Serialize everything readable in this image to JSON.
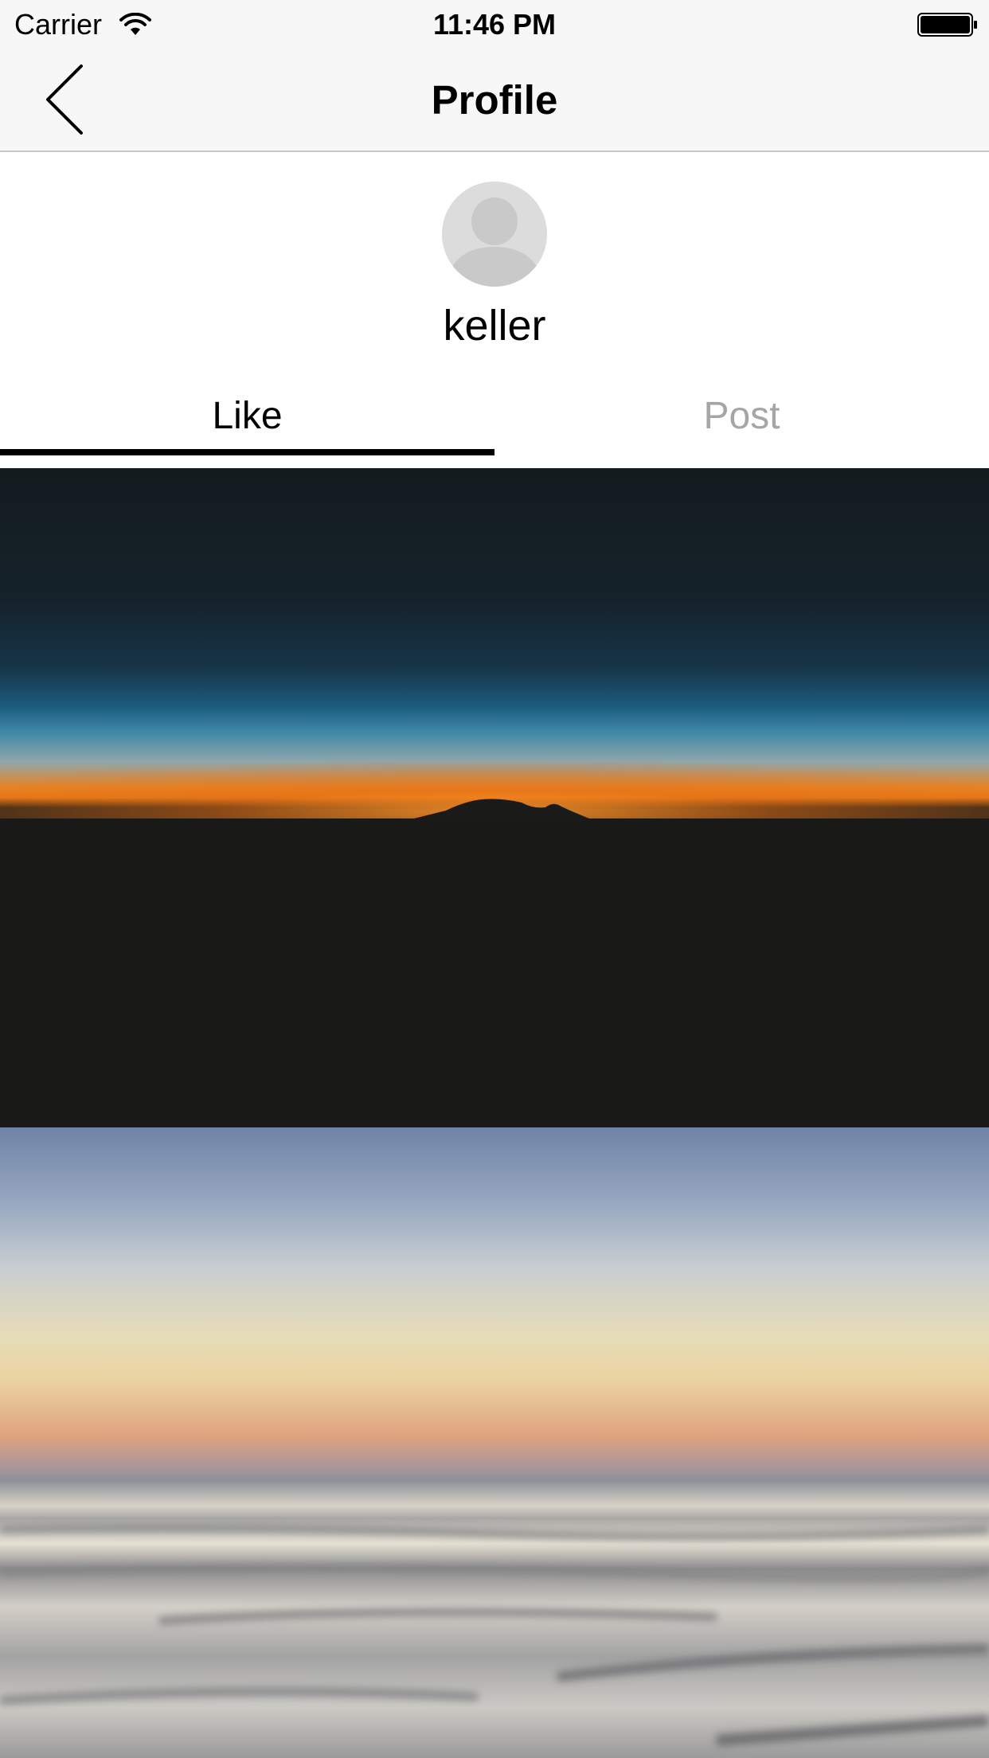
{
  "status_bar": {
    "carrier": "Carrier",
    "time": "11:46 PM",
    "icons": [
      "wifi-icon",
      "battery-icon"
    ]
  },
  "navbar": {
    "title": "Profile",
    "back_icon": "chevron-left-icon"
  },
  "profile": {
    "avatar_icon": "person-placeholder-icon",
    "username": "keller"
  },
  "tabs": [
    {
      "label": "Like",
      "selected": true
    },
    {
      "label": "Post",
      "selected": false
    }
  ],
  "feed": {
    "items": [
      {
        "kind": "photo",
        "subject": "sunset-horizon-photo"
      },
      {
        "kind": "photo",
        "subject": "blurred-seascape-photo"
      }
    ]
  },
  "colors": {
    "navbar_bg": "#f7f7f7",
    "tab_active": "#000000",
    "tab_inactive": "#a5a5a5",
    "indicator": "#000000",
    "avatar_bg": "#dcdcdc"
  }
}
